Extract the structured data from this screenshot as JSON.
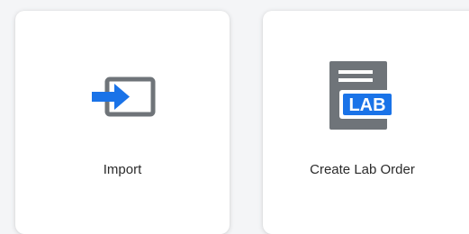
{
  "cards": [
    {
      "label": "Import",
      "icon": "import-icon"
    },
    {
      "label": "Create Lab Order",
      "icon": "lab-order-icon",
      "icon_text": "LAB"
    }
  ],
  "colors": {
    "accent_blue": "#1a73e8",
    "icon_gray": "#6f7479",
    "card_bg": "#ffffff",
    "page_bg": "#f4f5f7"
  }
}
